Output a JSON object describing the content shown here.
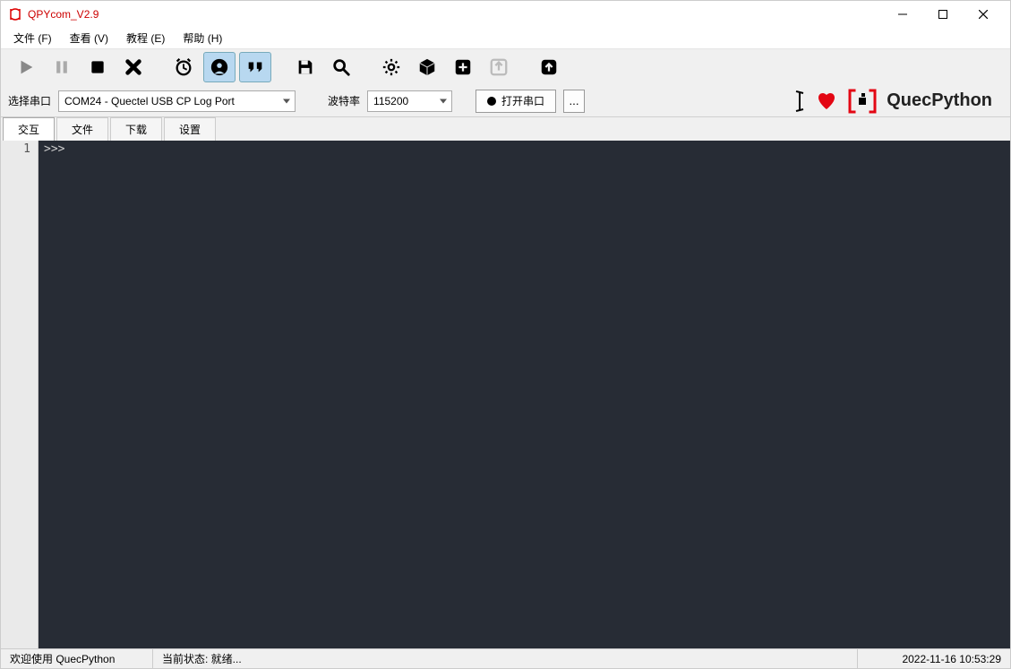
{
  "window": {
    "title": "QPYcom_V2.9"
  },
  "menu": {
    "file": "文件 (F)",
    "view": "查看 (V)",
    "tutorial": "教程 (E)",
    "help": "帮助 (H)"
  },
  "conn": {
    "port_label": "选择串口",
    "port_value": "COM24 - Quectel USB CP Log Port",
    "baud_label": "波特率",
    "baud_value": "115200",
    "open_label": "打开串口",
    "extra_label": "..."
  },
  "brand": {
    "text": "QuecPython"
  },
  "tabs": {
    "interact": "交互",
    "file": "文件",
    "download": "下载",
    "settings": "设置"
  },
  "editor": {
    "line_no": "1",
    "prompt": ">>> "
  },
  "status": {
    "welcome": "欢迎使用 QuecPython",
    "state": "当前状态: 就绪...",
    "time": "2022-11-16 10:53:29"
  }
}
